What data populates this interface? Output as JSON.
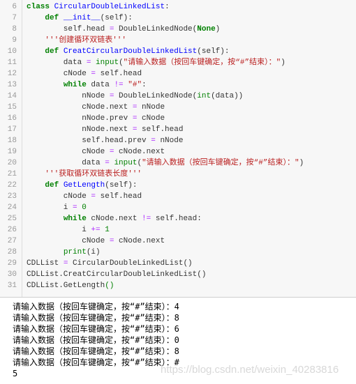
{
  "code": {
    "lines": [
      {
        "n": "6",
        "tokens": [
          {
            "t": "class",
            "c": "kw"
          },
          {
            "t": " "
          },
          {
            "t": "CircularDoubleLinkedList",
            "c": "nm"
          },
          {
            "t": ":"
          }
        ]
      },
      {
        "n": "7",
        "tokens": [
          {
            "t": "    "
          },
          {
            "t": "def",
            "c": "kw"
          },
          {
            "t": " "
          },
          {
            "t": "__init__",
            "c": "nm"
          },
          {
            "t": "(self):"
          }
        ]
      },
      {
        "n": "8",
        "tokens": [
          {
            "t": "        self.head "
          },
          {
            "t": "=",
            "c": "op"
          },
          {
            "t": " DoubleLinkedNode("
          },
          {
            "t": "None",
            "c": "kw"
          },
          {
            "t": ")"
          }
        ]
      },
      {
        "n": "9",
        "tokens": [
          {
            "t": "    "
          },
          {
            "t": "'''创建循环双链表'''",
            "c": "st"
          }
        ]
      },
      {
        "n": "10",
        "tokens": [
          {
            "t": "    "
          },
          {
            "t": "def",
            "c": "kw"
          },
          {
            "t": " "
          },
          {
            "t": "CreatCircularDoubleLinkedList",
            "c": "nm"
          },
          {
            "t": "(self):"
          }
        ]
      },
      {
        "n": "11",
        "tokens": [
          {
            "t": "        data "
          },
          {
            "t": "=",
            "c": "op"
          },
          {
            "t": " "
          },
          {
            "t": "input",
            "c": "bi"
          },
          {
            "t": "("
          },
          {
            "t": "\"请输入数据（按回车键确定，按“#”结束）：\"",
            "c": "st"
          },
          {
            "t": ")"
          }
        ]
      },
      {
        "n": "12",
        "tokens": [
          {
            "t": "        cNode "
          },
          {
            "t": "=",
            "c": "op"
          },
          {
            "t": " self.head"
          }
        ]
      },
      {
        "n": "13",
        "tokens": [
          {
            "t": "        "
          },
          {
            "t": "while",
            "c": "kw"
          },
          {
            "t": " data "
          },
          {
            "t": "!=",
            "c": "op"
          },
          {
            "t": " "
          },
          {
            "t": "\"#\"",
            "c": "st"
          },
          {
            "t": ":"
          }
        ]
      },
      {
        "n": "14",
        "tokens": [
          {
            "t": "            nNode "
          },
          {
            "t": "=",
            "c": "op"
          },
          {
            "t": " DoubleLinkedNode("
          },
          {
            "t": "int",
            "c": "bi"
          },
          {
            "t": "(data))"
          }
        ]
      },
      {
        "n": "15",
        "tokens": [
          {
            "t": "            cNode.next "
          },
          {
            "t": "=",
            "c": "op"
          },
          {
            "t": " nNode"
          }
        ]
      },
      {
        "n": "16",
        "tokens": [
          {
            "t": "            nNode.prev "
          },
          {
            "t": "=",
            "c": "op"
          },
          {
            "t": " cNode"
          }
        ]
      },
      {
        "n": "17",
        "tokens": [
          {
            "t": "            nNode.next "
          },
          {
            "t": "=",
            "c": "op"
          },
          {
            "t": " self.head"
          }
        ]
      },
      {
        "n": "18",
        "tokens": [
          {
            "t": "            self.head.prev "
          },
          {
            "t": "=",
            "c": "op"
          },
          {
            "t": " nNode"
          }
        ]
      },
      {
        "n": "19",
        "tokens": [
          {
            "t": "            cNode "
          },
          {
            "t": "=",
            "c": "op"
          },
          {
            "t": " cNode.next"
          }
        ]
      },
      {
        "n": "20",
        "tokens": [
          {
            "t": "            data "
          },
          {
            "t": "=",
            "c": "op"
          },
          {
            "t": " "
          },
          {
            "t": "input",
            "c": "bi"
          },
          {
            "t": "("
          },
          {
            "t": "\"请输入数据（按回车键确定，按“#”结束）：\"",
            "c": "st"
          },
          {
            "t": ")"
          }
        ]
      },
      {
        "n": "21",
        "tokens": [
          {
            "t": "    "
          },
          {
            "t": "'''获取循环双链表长度'''",
            "c": "st"
          }
        ]
      },
      {
        "n": "22",
        "tokens": [
          {
            "t": "    "
          },
          {
            "t": "def",
            "c": "kw"
          },
          {
            "t": " "
          },
          {
            "t": "GetLength",
            "c": "nm"
          },
          {
            "t": "(self):"
          }
        ]
      },
      {
        "n": "23",
        "tokens": [
          {
            "t": "        cNode "
          },
          {
            "t": "=",
            "c": "op"
          },
          {
            "t": " self.head"
          }
        ]
      },
      {
        "n": "24",
        "tokens": [
          {
            "t": "        i "
          },
          {
            "t": "=",
            "c": "op"
          },
          {
            "t": " "
          },
          {
            "t": "0",
            "c": "bi"
          }
        ]
      },
      {
        "n": "25",
        "tokens": [
          {
            "t": "        "
          },
          {
            "t": "while",
            "c": "kw"
          },
          {
            "t": " cNode.next "
          },
          {
            "t": "!=",
            "c": "op"
          },
          {
            "t": " self.head:"
          }
        ]
      },
      {
        "n": "26",
        "tokens": [
          {
            "t": "            i "
          },
          {
            "t": "+=",
            "c": "op"
          },
          {
            "t": " "
          },
          {
            "t": "1",
            "c": "bi"
          }
        ]
      },
      {
        "n": "27",
        "tokens": [
          {
            "t": "            cNode "
          },
          {
            "t": "=",
            "c": "op"
          },
          {
            "t": " cNode.next"
          }
        ]
      },
      {
        "n": "28",
        "tokens": [
          {
            "t": "        "
          },
          {
            "t": "print",
            "c": "bi"
          },
          {
            "t": "(i)"
          }
        ]
      },
      {
        "n": "29",
        "tokens": [
          {
            "t": "CDLList "
          },
          {
            "t": "=",
            "c": "op"
          },
          {
            "t": " CircularDoubleLinkedList()"
          }
        ]
      },
      {
        "n": "30",
        "tokens": [
          {
            "t": "CDLList.CreatCircularDoubleLinkedList()"
          }
        ]
      },
      {
        "n": "31",
        "tokens": [
          {
            "t": "CDLList.GetLength"
          },
          {
            "t": "()",
            "c": "bi"
          }
        ]
      }
    ]
  },
  "output": [
    "请输入数据（按回车键确定，按“#”结束）：4",
    "请输入数据（按回车键确定，按“#”结束）：8",
    "请输入数据（按回车键确定，按“#”结束）：6",
    "请输入数据（按回车键确定，按“#”结束）：0",
    "请输入数据（按回车键确定，按“#”结束）：8",
    "请输入数据（按回车键确定，按“#”结束）：#",
    "5"
  ],
  "watermark": "https://blog.csdn.net/weixin_40283816"
}
